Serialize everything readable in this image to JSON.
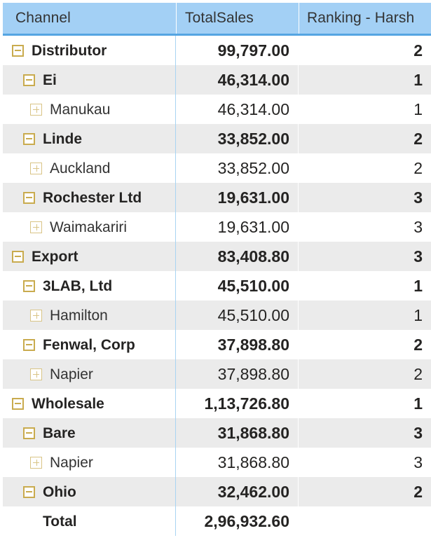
{
  "visual": {
    "type": "matrix-table",
    "colors": {
      "header_background": "#a3d0f5",
      "header_border": "#55a5e2",
      "row_band": "#ebebeb",
      "row_base": "#ffffff",
      "expander": "#c9ab4e",
      "expander_collapsed": "#d9c486",
      "column_divider": "#a8d4f2",
      "text": "#252423"
    }
  },
  "columns": [
    {
      "key": "channel",
      "label": "Channel",
      "align": "left"
    },
    {
      "key": "total_sales",
      "label": "TotalSales",
      "align": "right"
    },
    {
      "key": "ranking",
      "label": "Ranking - Harsh",
      "align": "right"
    }
  ],
  "rows": [
    {
      "level": 0,
      "icon": "minus-expander-icon",
      "label": "Distributor",
      "total_sales": "99,797.00",
      "ranking": "2",
      "banded": false
    },
    {
      "level": 1,
      "icon": "minus-expander-icon",
      "label": "Ei",
      "total_sales": "46,314.00",
      "ranking": "1",
      "banded": true
    },
    {
      "level": 2,
      "icon": "plus-expander-icon",
      "label": "Manukau",
      "total_sales": "46,314.00",
      "ranking": "1",
      "banded": false
    },
    {
      "level": 1,
      "icon": "minus-expander-icon",
      "label": "Linde",
      "total_sales": "33,852.00",
      "ranking": "2",
      "banded": true
    },
    {
      "level": 2,
      "icon": "plus-expander-icon",
      "label": "Auckland",
      "total_sales": "33,852.00",
      "ranking": "2",
      "banded": false
    },
    {
      "level": 1,
      "icon": "minus-expander-icon",
      "label": "Rochester Ltd",
      "total_sales": "19,631.00",
      "ranking": "3",
      "banded": true
    },
    {
      "level": 2,
      "icon": "plus-expander-icon",
      "label": "Waimakariri",
      "total_sales": "19,631.00",
      "ranking": "3",
      "banded": false
    },
    {
      "level": 0,
      "icon": "minus-expander-icon",
      "label": "Export",
      "total_sales": "83,408.80",
      "ranking": "3",
      "banded": true
    },
    {
      "level": 1,
      "icon": "minus-expander-icon",
      "label": "3LAB, Ltd",
      "total_sales": "45,510.00",
      "ranking": "1",
      "banded": false
    },
    {
      "level": 2,
      "icon": "plus-expander-icon",
      "label": "Hamilton",
      "total_sales": "45,510.00",
      "ranking": "1",
      "banded": true
    },
    {
      "level": 1,
      "icon": "minus-expander-icon",
      "label": "Fenwal, Corp",
      "total_sales": "37,898.80",
      "ranking": "2",
      "banded": false
    },
    {
      "level": 2,
      "icon": "plus-expander-icon",
      "label": "Napier",
      "total_sales": "37,898.80",
      "ranking": "2",
      "banded": true
    },
    {
      "level": 0,
      "icon": "minus-expander-icon",
      "label": "Wholesale",
      "total_sales": "1,13,726.80",
      "ranking": "1",
      "banded": false
    },
    {
      "level": 1,
      "icon": "minus-expander-icon",
      "label": "Bare",
      "total_sales": "31,868.80",
      "ranking": "3",
      "banded": true
    },
    {
      "level": 2,
      "icon": "plus-expander-icon",
      "label": "Napier",
      "total_sales": "31,868.80",
      "ranking": "3",
      "banded": false
    },
    {
      "level": 1,
      "icon": "minus-expander-icon",
      "label": "Ohio",
      "total_sales": "32,462.00",
      "ranking": "2",
      "banded": true
    }
  ],
  "total_row": {
    "level": 1,
    "icon": "none",
    "label": "Total",
    "total_sales": "2,96,932.60",
    "ranking": "",
    "banded": false
  }
}
